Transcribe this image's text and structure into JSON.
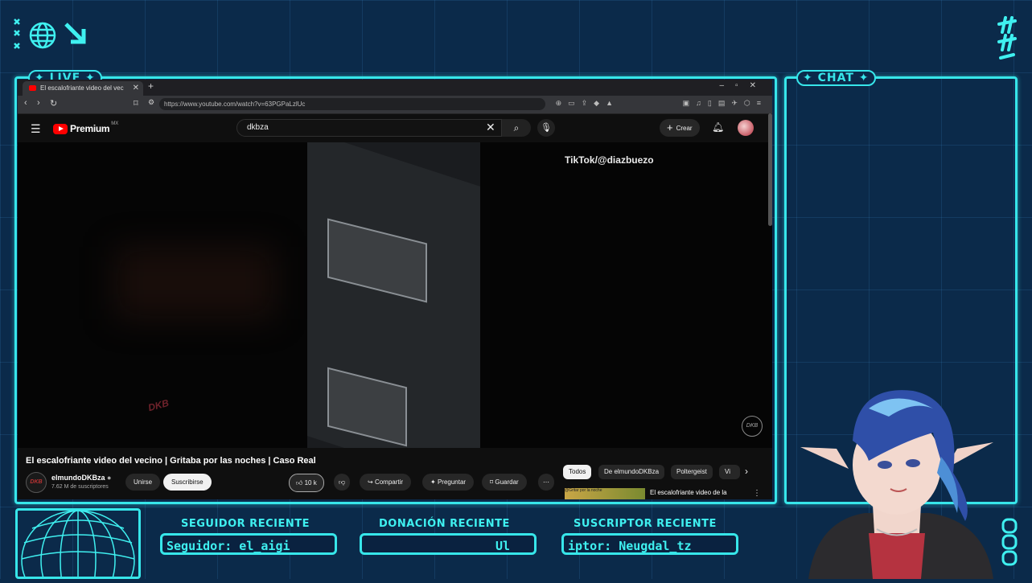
{
  "overlay": {
    "live_label": "LIVE",
    "chat_label": "CHAT",
    "recent_follower_title": "SEGUIDOR RECIENTE",
    "recent_follower_value": "Seguidor: el_aigi",
    "recent_donation_title": "DONACIÓN RECIENTE",
    "recent_donation_value": "Ul",
    "recent_subscriber_title": "SUSCRIPTOR RECIENTE",
    "recent_subscriber_value": "iptor: Neugdal_tz",
    "accent_color": "#37e6ea",
    "background_color": "#0b2a4a"
  },
  "browser": {
    "tab_title": "El escalofriante video del vec",
    "url": "https://www.youtube.com/watch?v=63PGPaLzlUc"
  },
  "youtube": {
    "logo_text": "Premium",
    "region": "MX",
    "search_value": "dkbza",
    "create_label": "Crear",
    "video_watermark": "TikTok/@diazbuezo",
    "video_logo": "DKB",
    "video_title": "El escalofriante video del vecino | Gritaba por las noches | Caso Real",
    "channel_name": "elmundoDKBza",
    "channel_subs": "7.62 M de suscriptores",
    "join_label": "Unirse",
    "subscribe_label": "Suscribirse",
    "like_count": "10 k",
    "share_label": "Compartir",
    "ask_label": "Preguntar",
    "save_label": "Guardar",
    "chips": [
      "Todos",
      "De elmundoDKBza",
      "Poltergeist",
      "Vi"
    ],
    "rec_title": "El escalofriante video de la",
    "rec_thumb_text": "@Gritar por la noche"
  }
}
